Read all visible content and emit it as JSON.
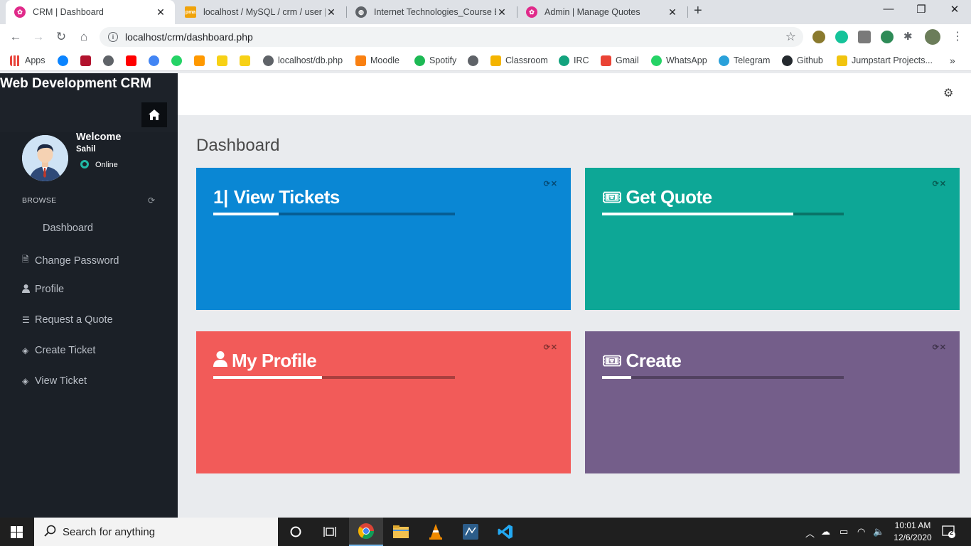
{
  "browser": {
    "tabs": [
      {
        "title": "CRM | Dashboard",
        "active": true
      },
      {
        "title": "localhost / MySQL / crm / user | p",
        "active": false
      },
      {
        "title": "Internet Technologies_Course Eva",
        "active": false
      },
      {
        "title": "Admin | Manage Quotes",
        "active": false
      }
    ],
    "url": "localhost/crm/dashboard.php",
    "bookmarks": [
      "Apps",
      "localhost/db.php",
      "Moodle",
      "Spotify",
      "Classroom",
      "IRC",
      "Gmail",
      "WhatsApp",
      "Telegram",
      "Github",
      "Jumpstart Projects..."
    ]
  },
  "sidebar": {
    "brand": "Web Development CRM",
    "welcome": "Welcome",
    "user_name": "Sahil",
    "status": "Online",
    "section_label": "BROWSE",
    "items": [
      {
        "label": "Dashboard",
        "icon": "none"
      },
      {
        "label": "Change Password",
        "icon": "file-icon"
      },
      {
        "label": "Profile",
        "icon": "user-icon"
      },
      {
        "label": "Request a Quote",
        "icon": "list-icon"
      },
      {
        "label": "Create Ticket",
        "icon": "ticket-icon"
      },
      {
        "label": "View Ticket",
        "icon": "ticket-icon"
      }
    ]
  },
  "main": {
    "page_title": "Dashboard",
    "cards": [
      {
        "title": "View Tickets",
        "prefix": "1|",
        "icon": "none",
        "color": "#0a87d4",
        "progress": 0.27
      },
      {
        "title": "Get Quote",
        "icon": "ticket-icon",
        "color": "#0da796",
        "progress": 0.79
      },
      {
        "title": "My Profile",
        "icon": "user-icon",
        "color": "#f25b59",
        "progress": 0.45
      },
      {
        "title": "Create",
        "icon": "ticket-icon",
        "color": "#745e8a",
        "progress": 0.12
      }
    ]
  },
  "taskbar": {
    "search_placeholder": "Search for anything",
    "time": "10:01 AM",
    "date": "12/6/2020",
    "notifications": "2"
  }
}
